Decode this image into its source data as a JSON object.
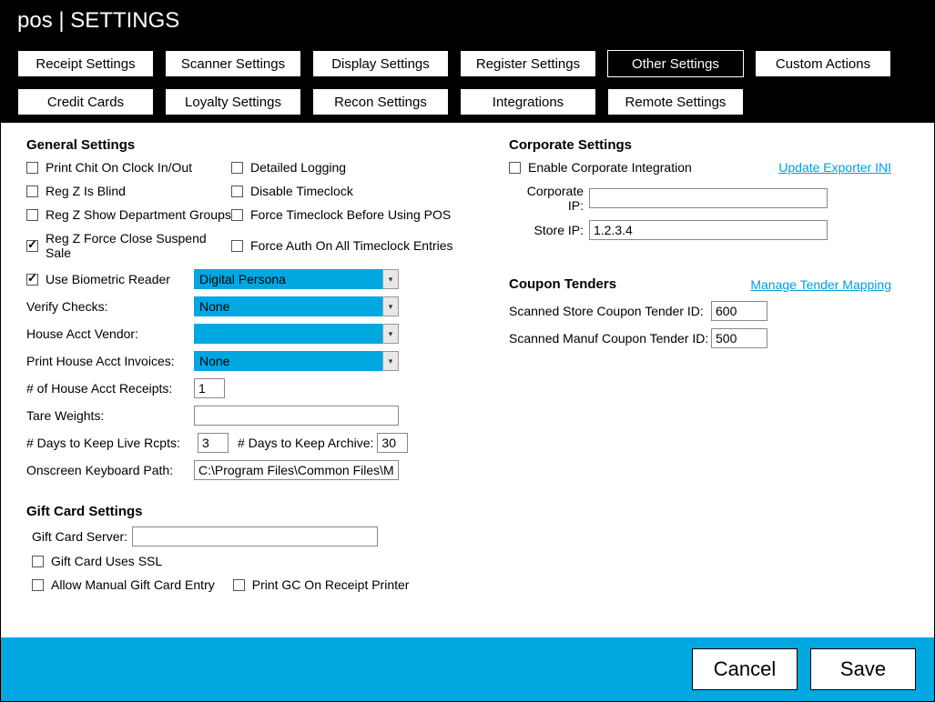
{
  "header": {
    "title": "pos | SETTINGS"
  },
  "tabs": {
    "row1": [
      {
        "label": "Receipt Settings",
        "active": false
      },
      {
        "label": "Scanner Settings",
        "active": false
      },
      {
        "label": "Display Settings",
        "active": false
      },
      {
        "label": "Register Settings",
        "active": false
      },
      {
        "label": "Other Settings",
        "active": true
      },
      {
        "label": "Custom Actions",
        "active": false
      }
    ],
    "row2": [
      {
        "label": "Credit Cards",
        "active": false
      },
      {
        "label": "Loyalty Settings",
        "active": false
      },
      {
        "label": "Recon Settings",
        "active": false
      },
      {
        "label": "Integrations",
        "active": false
      },
      {
        "label": "Remote Settings",
        "active": false
      }
    ]
  },
  "general": {
    "title": "General Settings",
    "checks": {
      "print_chit": {
        "label": "Print Chit On Clock In/Out",
        "checked": false
      },
      "detailed_logging": {
        "label": "Detailed Logging",
        "checked": false
      },
      "regz_blind": {
        "label": "Reg Z Is Blind",
        "checked": false
      },
      "disable_timeclock": {
        "label": "Disable Timeclock",
        "checked": false
      },
      "regz_dept": {
        "label": "Reg Z Show Department Groups",
        "checked": false
      },
      "force_timeclock": {
        "label": "Force Timeclock Before Using POS",
        "checked": false
      },
      "regz_force_close": {
        "label": "Reg Z Force Close Suspend Sale",
        "checked": true
      },
      "force_auth": {
        "label": "Force Auth On All Timeclock Entries",
        "checked": false
      },
      "use_biometric": {
        "label": "Use Biometric Reader",
        "checked": true
      }
    },
    "biometric_value": "Digital Persona",
    "verify_checks_label": "Verify Checks:",
    "verify_checks_value": "None",
    "house_vendor_label": "House Acct Vendor:",
    "house_vendor_value": "",
    "print_house_label": "Print House Acct Invoices:",
    "print_house_value": "None",
    "num_receipts_label": "# of House Acct Receipts:",
    "num_receipts_value": "1",
    "tare_label": "Tare Weights:",
    "tare_value": "",
    "days_live_label": "# Days to Keep Live Rcpts:",
    "days_live_value": "3",
    "days_archive_label": "# Days to Keep Archive:",
    "days_archive_value": "30",
    "onscreen_label": "Onscreen Keyboard Path:",
    "onscreen_value": "C:\\Program Files\\Common Files\\Microso"
  },
  "giftcard": {
    "title": "Gift Card Settings",
    "server_label": "Gift Card Server:",
    "server_value": "",
    "uses_ssl": {
      "label": "Gift Card Uses SSL",
      "checked": false
    },
    "allow_manual": {
      "label": "Allow Manual Gift Card Entry",
      "checked": false
    },
    "print_gc": {
      "label": "Print GC On Receipt Printer",
      "checked": false
    }
  },
  "corporate": {
    "title": "Corporate Settings",
    "enable": {
      "label": "Enable Corporate Integration",
      "checked": false
    },
    "update_link": "Update Exporter INI",
    "corp_ip_label": "Corporate IP:",
    "corp_ip_value": "",
    "store_ip_label": "Store IP:",
    "store_ip_value": "1.2.3.4"
  },
  "coupon": {
    "title": "Coupon Tenders",
    "manage_link": "Manage Tender Mapping",
    "store_label": "Scanned Store Coupon Tender ID:",
    "store_value": "600",
    "manuf_label": "Scanned Manuf Coupon Tender ID:",
    "manuf_value": "500"
  },
  "footer": {
    "cancel": "Cancel",
    "save": "Save"
  }
}
